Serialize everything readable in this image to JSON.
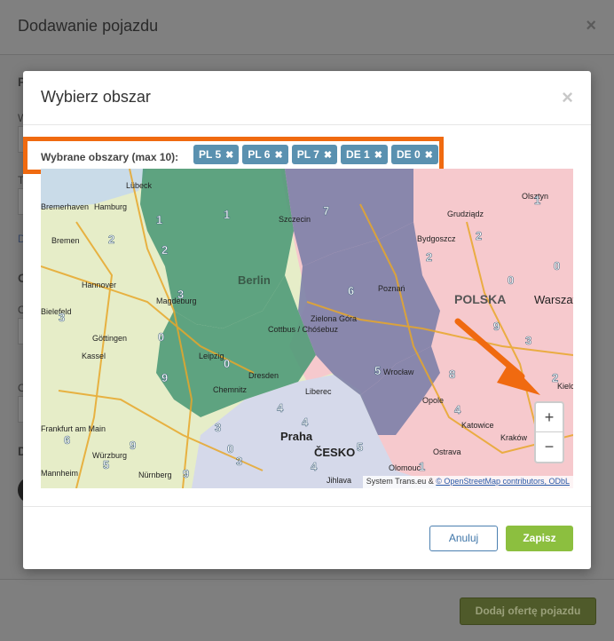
{
  "background_dialog": {
    "title": "Dodawanie pojazdu",
    "close_icon": "×",
    "submit_label": "Dodaj ofertę pojazdu",
    "fragments": [
      "P",
      "W",
      "T",
      "D",
      "O",
      "O",
      "O",
      "D"
    ]
  },
  "modal": {
    "title": "Wybierz obszar",
    "close_icon": "×",
    "selected_label": "Wybrane obszary (max 10):",
    "chips": [
      {
        "label": "PL 5",
        "remove_icon": "✖"
      },
      {
        "label": "PL 6",
        "remove_icon": "✖"
      },
      {
        "label": "PL 7",
        "remove_icon": "✖"
      },
      {
        "label": "DE 1",
        "remove_icon": "✖"
      },
      {
        "label": "DE 0",
        "remove_icon": "✖"
      }
    ],
    "cancel_label": "Anuluj",
    "save_label": "Zapisz"
  },
  "map": {
    "zoom_in": "+",
    "zoom_out": "−",
    "attribution_prefix": "System Trans.eu & ",
    "attribution_link": "© OpenStreetMap contributors, ODbL",
    "colors": {
      "selected_de": "#4f9a78",
      "selected_pl": "#7d7fa8",
      "germany": "#e6edc8",
      "poland": "#f6c9cd",
      "czechia": "#d5d9ea",
      "sea": "#c9dbe8",
      "arrow": "#f06a10"
    },
    "cities": [
      "Lübeck",
      "Hamburg",
      "Bremerhaven",
      "Bremen",
      "Hannover",
      "Magdeburg",
      "Bielefeld",
      "Göttingen",
      "Kassel",
      "Frankfurt am Main",
      "Würzburg",
      "Nürnberg",
      "Mannheim",
      "Berlin",
      "Szczecin",
      "Leipzig",
      "Dresden",
      "Chemnitz",
      "Cottbus / Chóśebuz",
      "Zielona Góra",
      "Poznań",
      "Wrocław",
      "Liberec",
      "Praha",
      "ČESKO",
      "Olomouc",
      "Jihlava",
      "Ostrava",
      "Opole",
      "Katowice",
      "Kraków",
      "Kielce",
      "Bydgoszcz",
      "Grudziądz",
      "Olsztyn",
      "POLSKA",
      "Warszawa"
    ],
    "region_numbers": [
      "1",
      "1",
      "2",
      "2",
      "3",
      "3",
      "0",
      "0",
      "9",
      "6",
      "9",
      "9",
      "5",
      "7",
      "6",
      "5",
      "4",
      "4",
      "3",
      "5",
      "3",
      "4",
      "2",
      "0",
      "9",
      "2",
      "1",
      "4",
      "8",
      "1",
      "3",
      "2",
      "0",
      "0"
    ]
  }
}
